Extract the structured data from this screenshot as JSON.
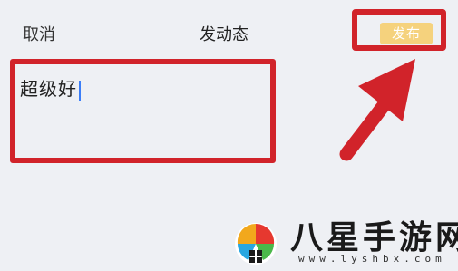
{
  "header": {
    "cancel_label": "取消",
    "title": "发动态",
    "publish_label": "发布"
  },
  "editor": {
    "content": "超级好"
  },
  "watermark": {
    "brand": "八星手游网",
    "url": "www.lyshbx.com"
  },
  "colors": {
    "highlight": "#d1232a",
    "publish_button": "#f5d27d",
    "cursor": "#3b7ef8",
    "background": "#eef0f4"
  },
  "icons": {
    "annotation_arrow": "arrow-up-right-icon",
    "watermark_logo": "lyshbx-logo-icon"
  }
}
